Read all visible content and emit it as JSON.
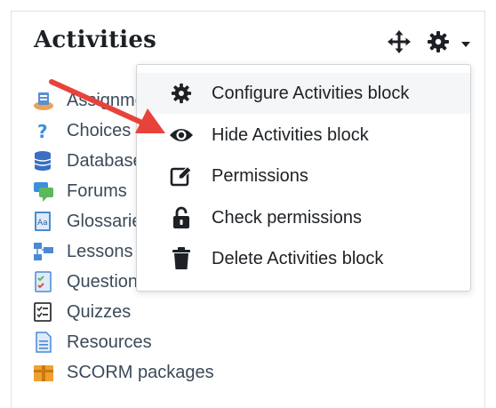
{
  "block": {
    "title": "Activities"
  },
  "controls": {
    "move_icon": "move-arrows-icon",
    "settings_icon": "gear-icon",
    "dropdown_icon": "caret-down-icon"
  },
  "activities": [
    {
      "label": "Assignments",
      "icon": "assignment-icon"
    },
    {
      "label": "Choices",
      "icon": "question-mark-icon"
    },
    {
      "label": "Databases",
      "icon": "database-icon"
    },
    {
      "label": "Forums",
      "icon": "forum-icon"
    },
    {
      "label": "Glossaries",
      "icon": "glossary-icon"
    },
    {
      "label": "Lessons",
      "icon": "lesson-icon"
    },
    {
      "label": "Questionnaires",
      "icon": "questionnaire-icon"
    },
    {
      "label": "Quizzes",
      "icon": "quiz-icon"
    },
    {
      "label": "Resources",
      "icon": "resource-icon"
    },
    {
      "label": "SCORM packages",
      "icon": "scorm-package-icon"
    }
  ],
  "menu": {
    "items": [
      {
        "label": "Configure Activities block",
        "icon": "gear-icon"
      },
      {
        "label": "Hide Activities block",
        "icon": "eye-icon"
      },
      {
        "label": "Permissions",
        "icon": "edit-icon"
      },
      {
        "label": "Check permissions",
        "icon": "unlock-icon"
      },
      {
        "label": "Delete Activities block",
        "icon": "trash-icon"
      }
    ]
  },
  "colors": {
    "accent": "#1d2125",
    "link": "#3b4a5a",
    "annotation_arrow": "#e8433a"
  }
}
